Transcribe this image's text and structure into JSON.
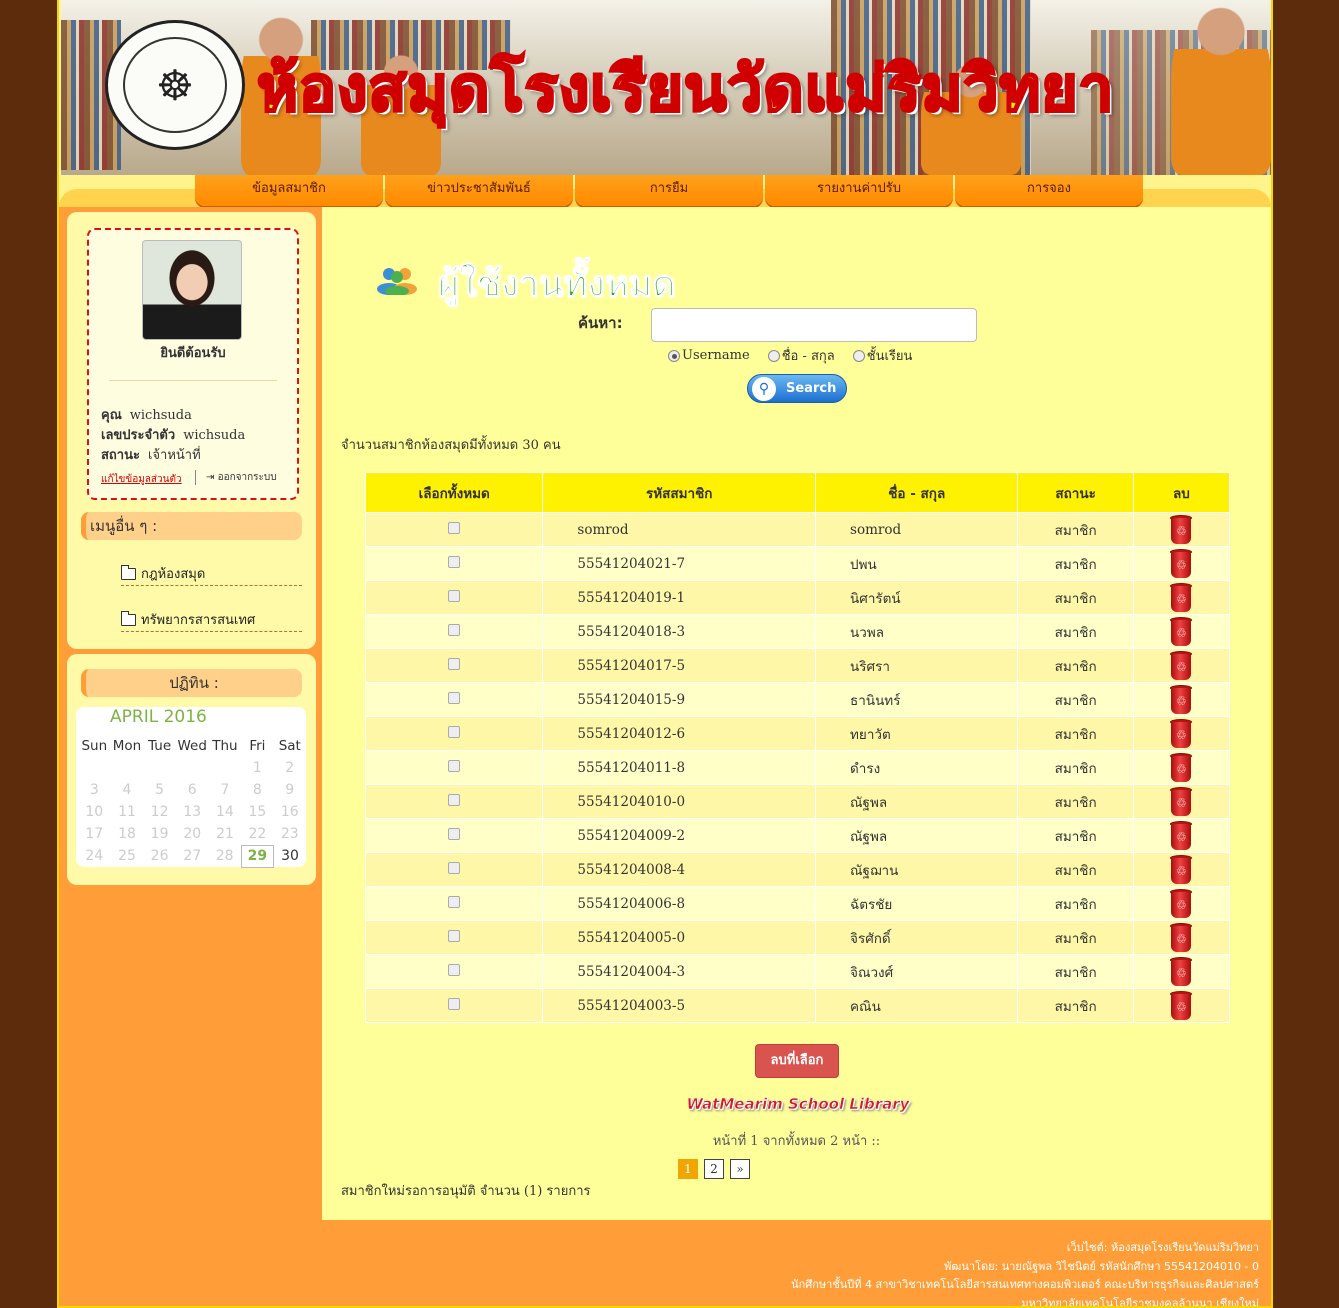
{
  "banner": {
    "title": "ห้องสมุดโรงเรียนวัดแม่ริมวิทยา"
  },
  "nav": {
    "items": [
      "ข้อมูลสมาชิก",
      "ข่าวประชาสัมพันธ์",
      "การยืม",
      "รายงานค่าปรับ",
      "การจอง"
    ]
  },
  "profile": {
    "welcome": "ยินดีต้อนรับ",
    "name_label": "คุณ",
    "name_value": "wichsuda",
    "id_label": "เลขประจำตัว",
    "id_value": "wichsuda",
    "status_label": "สถานะ",
    "status_value": "เจ้าหน้าที่",
    "edit_link": "แก้ไขข้อมูลส่วนตัว",
    "logout": "ออกจากระบบ"
  },
  "other_menu": {
    "heading": "เมนูอื่น ๆ :",
    "items": [
      "กฎห้องสมุด",
      "ทรัพยากรสารสนเทศ"
    ]
  },
  "calendar": {
    "heading": "ปฏิทิน :",
    "month": "APRIL 2016",
    "days": [
      "Sun",
      "Mon",
      "Tue",
      "Wed",
      "Thu",
      "Fri",
      "Sat"
    ],
    "weeks": [
      [
        "",
        "",
        "",
        "",
        "",
        "1",
        "2"
      ],
      [
        "3",
        "4",
        "5",
        "6",
        "7",
        "8",
        "9"
      ],
      [
        "10",
        "11",
        "12",
        "13",
        "14",
        "15",
        "16"
      ],
      [
        "17",
        "18",
        "19",
        "20",
        "21",
        "22",
        "23"
      ],
      [
        "24",
        "25",
        "26",
        "27",
        "28",
        "29",
        "30"
      ]
    ],
    "today": "29"
  },
  "main": {
    "title": "ผู้ใช้งานทั้งหมด",
    "search_label": "ค้นหา:",
    "search_value": "",
    "radio_options": [
      "Username",
      "ชื่อ - สกุล",
      "ชั้นเรียน"
    ],
    "radio_selected": "Username",
    "search_button": "Search",
    "member_count_text": "จำนวนสมาชิกห้องสมุดมีทั้งหมด 30 คน",
    "table": {
      "headers": [
        "เลือกทั้งหมด",
        "รหัสสมาชิก",
        "ชื่อ - สกุล",
        "สถานะ",
        "ลบ"
      ],
      "rows": [
        [
          "somrod",
          "somrod",
          "สมาชิก"
        ],
        [
          "55541204021-7",
          "ปพน",
          "สมาชิก"
        ],
        [
          "55541204019-1",
          "นิศารัตน์",
          "สมาชิก"
        ],
        [
          "55541204018-3",
          "นวพล",
          "สมาชิก"
        ],
        [
          "55541204017-5",
          "นริศรา",
          "สมาชิก"
        ],
        [
          "55541204015-9",
          "ธานินทร์",
          "สมาชิก"
        ],
        [
          "55541204012-6",
          "ทยาวัต",
          "สมาชิก"
        ],
        [
          "55541204011-8",
          "ดำรง",
          "สมาชิก"
        ],
        [
          "55541204010-0",
          "ณัฐพล",
          "สมาชิก"
        ],
        [
          "55541204009-2",
          "ณัฐพล",
          "สมาชิก"
        ],
        [
          "55541204008-4",
          "ณัฐฌาน",
          "สมาชิก"
        ],
        [
          "55541204006-8",
          "ฉัตรชัย",
          "สมาชิก"
        ],
        [
          "55541204005-0",
          "จิรศักดิ์",
          "สมาชิก"
        ],
        [
          "55541204004-3",
          "จิณวงศ์",
          "สมาชิก"
        ],
        [
          "55541204003-5",
          "คณิน",
          "สมาชิก"
        ]
      ]
    },
    "delete_selected": "ลบที่เลือก",
    "wordmark": "WatMearim School Library",
    "page_info": "หน้าที่ 1 จากทั้งหมด 2 หน้า ::",
    "pages": [
      "1",
      "2",
      "»"
    ],
    "current_page": "1",
    "pending_text": "สมาชิกใหม่รอการอนุมัติ จำนวน (1) รายการ"
  },
  "footer": {
    "lines": [
      "เว็บไซต์: ห้องสมุดโรงเรียนวัดแม่ริมวิทยา",
      "พัฒนาโดย: นายณัฐพล วิไชนิตย์ รหัสนักศึกษา 55541204010 - 0",
      "นักศึกษาชั้นปีที่ 4 สาขาวิชาเทคโนโลยีสารสนเทศทางคอมพิวเตอร์ คณะบริหารธุรกิจและศิลปศาสตร์",
      "มหาวิทยาลัยเทคโนโลยีราชมงคลล้านนา เชียงใหม่"
    ]
  },
  "colors": {
    "accent": "#ff9e38",
    "table_header": "#fff200",
    "danger": "#d9534f",
    "title_green": "#1fa91f"
  }
}
